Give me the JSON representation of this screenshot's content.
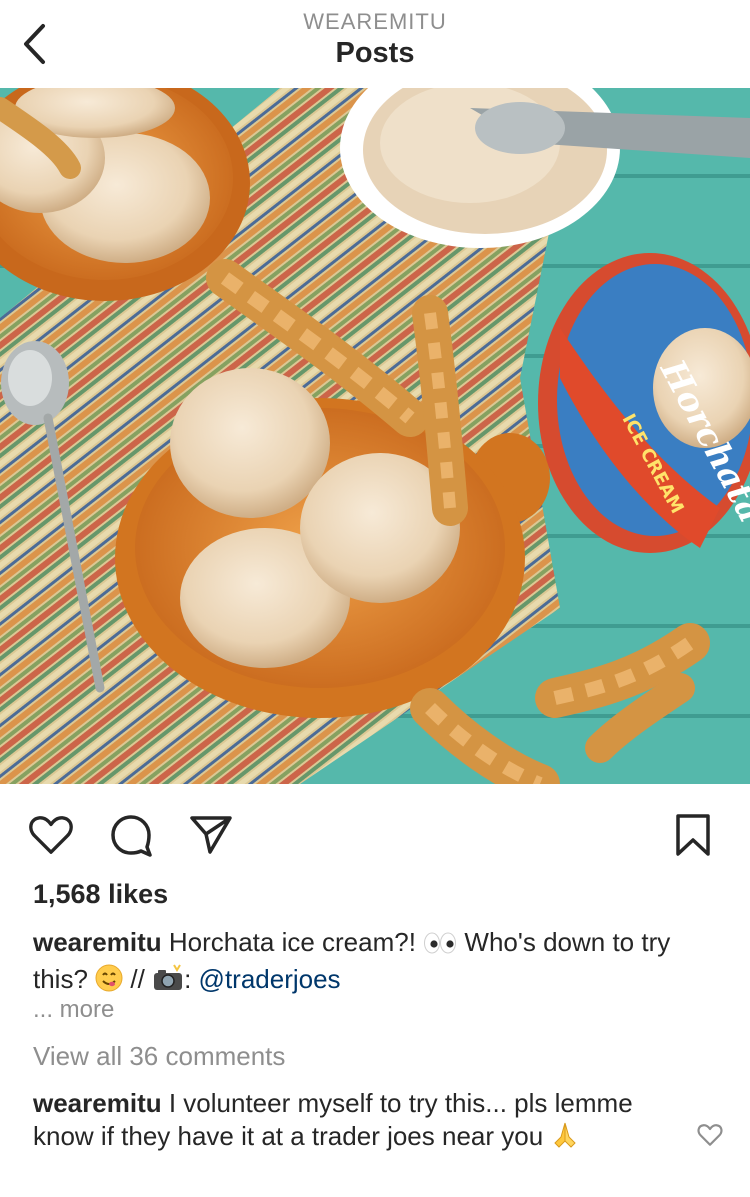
{
  "header": {
    "account": "WEAREMITU",
    "title": "Posts"
  },
  "post": {
    "image_alt_icon": "ice-cream-photo",
    "likes": "1,568 likes",
    "caption": {
      "username": "wearemitu",
      "text_1": "Horchata ice cream?!",
      "text_2": "Who's down to try this?",
      "text_3": "//",
      "text_4": ":",
      "mention": "@traderjoes"
    },
    "more_label": "... more",
    "view_comments": "View all 36 comments",
    "top_comment": {
      "username": "wearemitu",
      "text": "I volunteer myself to try this... pls lemme know if they have it at a trader joes near you"
    }
  },
  "product": {
    "brand": "Horchata",
    "subtitle": "ICE CREAM"
  },
  "icons": [
    "chevron-left-icon",
    "heart-icon",
    "comment-icon",
    "send-icon",
    "bookmark-icon",
    "eyes-emoji",
    "yum-emoji",
    "camera-flash-emoji",
    "praying-hands-emoji"
  ],
  "colors": {
    "text": "#262626",
    "muted": "#8e8e8e",
    "mention": "#00376b",
    "table": "#54b9ac",
    "bowl": "#e2852b"
  }
}
